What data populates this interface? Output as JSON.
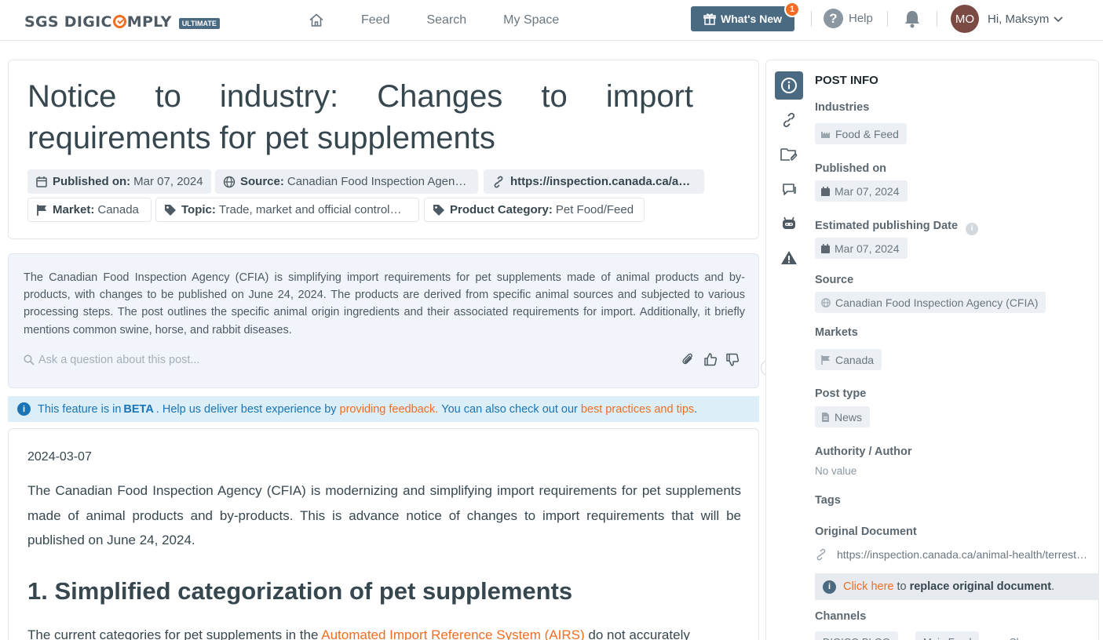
{
  "nav": {
    "logo": "SGS DIGICOMPLY",
    "logo_prefix": "SGS DIGIC",
    "logo_suffix": "MPLY",
    "logo_badge": "ULTIMATE",
    "items": [
      {
        "label": "Feed"
      },
      {
        "label": "Search"
      },
      {
        "label": "My Space"
      }
    ],
    "whats_new": "What's New",
    "whats_new_count": "1",
    "help": "Help",
    "avatar_initials": "MO",
    "greeting": "Hi, Maksym"
  },
  "post": {
    "title": "Notice to industry: Changes to import requirements for pet supplements",
    "published_label": "Published on:",
    "published_value": "Mar 07, 2024",
    "source_label": "Source:",
    "source_value": "Canadian Food Inspection Agen…",
    "url": "https://inspection.canada.ca/ani…",
    "market_label": "Market:",
    "market_value": "Canada",
    "topic_label": "Topic:",
    "topic_value": "Trade, market and official control…",
    "category_label": "Product Category:",
    "category_value": "Pet Food/Feed"
  },
  "summary": {
    "text": "The Canadian Food Inspection Agency (CFIA) is simplifying import requirements for pet supplements made of animal products and by-products, with changes to be published on June 24, 2024. The products are derived from specific animal sources and subjected to various processing steps. The post outlines the specific animal origin ingredients and their associated requirements for import. Additionally, it briefly mentions common swine, horse, and rabbit diseases.",
    "ask_placeholder": "Ask a question about this post..."
  },
  "beta": {
    "prefix": "This feature is in",
    "beta_word": "BETA",
    "middle": ". Help us deliver best experience by",
    "feedback_link": "providing feedback.",
    "middle2": "You can also check out our",
    "tips_link": "best practices and tips",
    "end": "."
  },
  "body": {
    "date": "2024-03-07",
    "paragraph": "The Canadian Food Inspection Agency (CFIA) is modernizing and simplifying import requirements for pet supplements made of animal products and by-products. This is advance notice of changes to import requirements that will be published on June 24, 2024.",
    "heading": "1. Simplified categorization of pet supplements",
    "para2_start": "The current categories for pet supplements in the",
    "para2_link": "Automated Import Reference System (AIRS)",
    "para2_end": "do not accurately"
  },
  "side": {
    "title": "POST INFO",
    "industries_label": "Industries",
    "industries_value": "Food & Feed",
    "published_label": "Published on",
    "published_value": "Mar 07, 2024",
    "est_label": "Estimated publishing Date",
    "est_value": "Mar 07, 2024",
    "source_label": "Source",
    "source_value": "Canadian Food Inspection Agency (CFIA)",
    "markets_label": "Markets",
    "markets_value": "Canada",
    "posttype_label": "Post type",
    "posttype_value": "News",
    "author_label": "Authority / Author",
    "author_value": "No value",
    "tags_label": "Tags",
    "origdoc_label": "Original Document",
    "origdoc_value": "https://inspection.canada.ca/animal-health/terrest…",
    "replace_link": "Click here",
    "replace_to": "to",
    "replace_bold": "replace original document",
    "replace_end": ".",
    "channels_label": "Channels",
    "channels": [
      "DIGICO BLOG",
      "Main Feed",
      "Share…"
    ]
  },
  "colors": {
    "accent": "#4a6a82",
    "orange": "#f26d21",
    "info_blue": "#1a74b5"
  }
}
